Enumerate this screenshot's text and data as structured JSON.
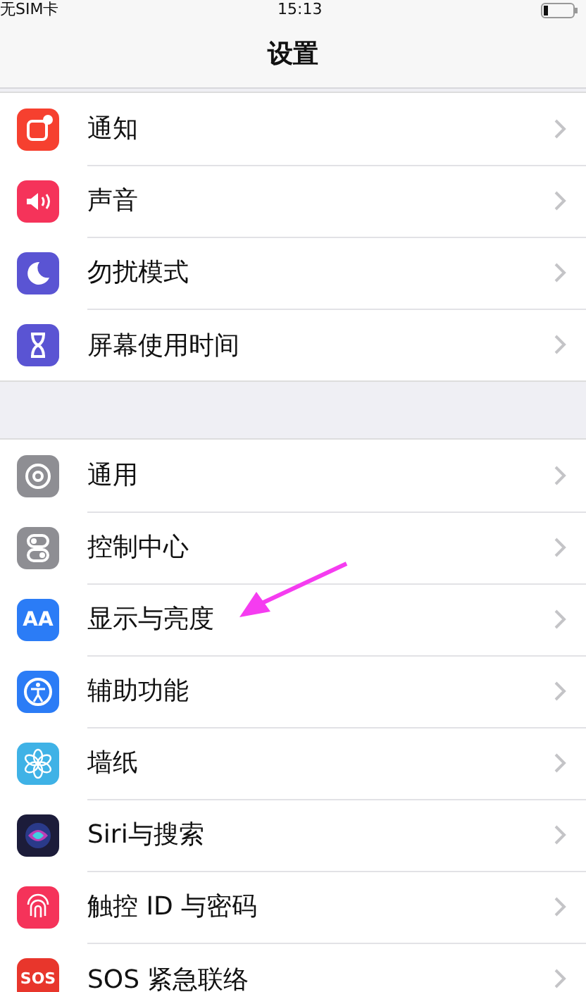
{
  "status_bar": {
    "carrier": "无SIM卡",
    "time": "15:13"
  },
  "nav": {
    "title": "设置"
  },
  "groups": [
    {
      "items": [
        {
          "label": "通知",
          "color": "#f6402f"
        },
        {
          "label": "声音",
          "color": "#f5335a"
        },
        {
          "label": "勿扰模式",
          "color": "#5a54d3"
        },
        {
          "label": "屏幕使用时间",
          "color": "#5a54d3"
        }
      ]
    },
    {
      "items": [
        {
          "label": "通用",
          "color": "#8e8e93"
        },
        {
          "label": "控制中心",
          "color": "#8e8e93"
        },
        {
          "label": "显示与亮度",
          "color": "#2b7cf6",
          "icon_text": "AA"
        },
        {
          "label": "辅助功能",
          "color": "#2b7cf6"
        },
        {
          "label": "墙纸",
          "color": "#3fb2e6"
        },
        {
          "label": "Siri与搜索",
          "color": "#1c1c3a"
        },
        {
          "label": "触控 ID 与密码",
          "color": "#f5335a"
        },
        {
          "label": "SOS 紧急联络",
          "color": "#e8362c",
          "icon_text": "SOS"
        }
      ]
    }
  ],
  "annotation": {
    "kind": "arrow",
    "color": "#f53cf0"
  }
}
